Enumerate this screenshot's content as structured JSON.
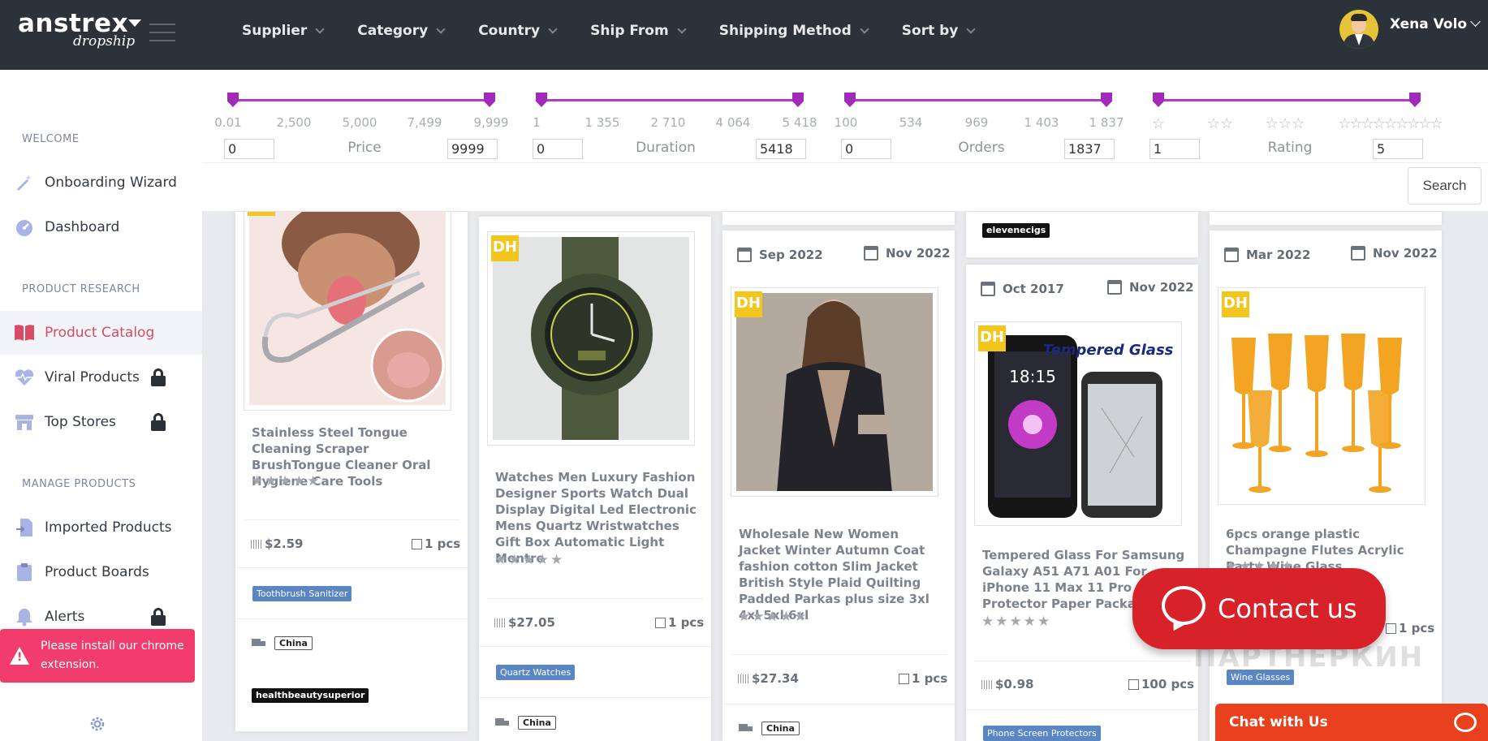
{
  "header": {
    "logo_main": "anstrex",
    "logo_sub": "dropship",
    "nav": [
      "Supplier",
      "Category",
      "Country",
      "Ship From",
      "Shipping Method",
      "Sort by"
    ],
    "user_name": "Xena Volo"
  },
  "sidebar": {
    "sections": [
      "WELCOME",
      "PRODUCT RESEARCH",
      "MANAGE PRODUCTS"
    ],
    "items": [
      {
        "label": "Onboarding Wizard",
        "icon": "magic-wand-icon",
        "locked": false
      },
      {
        "label": "Dashboard",
        "icon": "dashboard-gauge-icon",
        "locked": false
      },
      {
        "label": "Product Catalog",
        "icon": "open-book-icon",
        "locked": false,
        "active": true
      },
      {
        "label": "Viral Products",
        "icon": "heart-pulse-icon",
        "locked": true
      },
      {
        "label": "Top Stores",
        "icon": "store-icon",
        "locked": true
      },
      {
        "label": "Imported Products",
        "icon": "import-file-icon",
        "locked": false
      },
      {
        "label": "Product Boards",
        "icon": "clipboard-icon",
        "locked": false
      },
      {
        "label": "Alerts",
        "icon": "bell-icon",
        "locked": true
      }
    ],
    "alert": "Please install our chrome extension."
  },
  "filters": {
    "price": {
      "label": "Price",
      "ticks": [
        "0.01",
        "2,500",
        "5,000",
        "7,499",
        "9,999"
      ],
      "min": "0",
      "max": "9999"
    },
    "duration": {
      "label": "Duration",
      "ticks": [
        "1",
        "1 355",
        "2 710",
        "4 064",
        "5 418"
      ],
      "min": "0",
      "max": "5418"
    },
    "orders": {
      "label": "Orders",
      "ticks": [
        "100",
        "534",
        "969",
        "1 403",
        "1 837"
      ],
      "min": "0",
      "max": "1837"
    },
    "rating": {
      "label": "Rating",
      "min": "1",
      "max": "5"
    },
    "search_label": "Search"
  },
  "products": [
    {
      "title": "Stainless Steel Tongue Cleaning Scraper BrushTongue Cleaner Oral Hygiene Care Tools",
      "price": "$2.59",
      "qty": "1 pcs",
      "category": "Toothbrush Sanitizer",
      "ship_from": "China",
      "store": "healthbeautysuperior"
    },
    {
      "title": "Watches Men Luxury Fashion Designer Sports Watch Dual Display Digital Led Electronic Mens Quartz Wristwatches Gift Box Automatic Light Montre",
      "price": "$27.05",
      "qty": "1 pcs",
      "category": "Quartz Watches",
      "ship_from": "China"
    },
    {
      "date_start": "Sep 2022",
      "date_end": "Nov 2022",
      "title": "Wholesale New Women Jacket Winter Autumn Coat fashion cotton Slim Jacket British Style Plaid Quilting Padded Parkas plus size 3xl 4xl 5xl 6xl",
      "price": "$27.34",
      "qty": "1 pcs",
      "ship_from": "China"
    },
    {
      "store_top": "elevenecigs",
      "date_start": "Oct 2017",
      "date_end": "Nov 2022",
      "title": "Tempered Glass For Samsung Galaxy A51 A71 A01 For iPhone 11 Max 11 Pro Screen Protector Paper Package D1",
      "image_text": "Tempered Glass",
      "phone_time": "18:15",
      "price": "$0.98",
      "qty": "100 pcs",
      "category": "Phone Screen Protectors"
    },
    {
      "date_start": "Mar 2022",
      "date_end": "Nov 2022",
      "title": "6pcs orange plastic Champagne Flutes Acrylic Party Wine Glass",
      "qty": "1 pcs",
      "category": "Wine Glasses"
    }
  ],
  "badge_text": "DH",
  "contact_label": "Contact us",
  "chat_label": "Chat with Us",
  "watermark": "ПАРТНЕРКИН",
  "colors": {
    "accent": "#d74b66",
    "slider": "#b43ac7",
    "alert": "#f23c6e",
    "contact": "#d7222a",
    "chat": "#e9401d",
    "tag": "#5a86c4"
  }
}
